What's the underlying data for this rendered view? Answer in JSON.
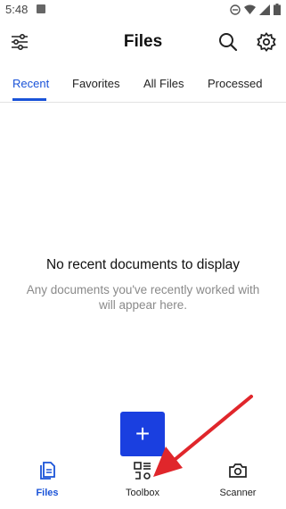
{
  "status_bar": {
    "time": "5:48"
  },
  "header": {
    "title": "Files"
  },
  "tabs": [
    {
      "label": "Recent"
    },
    {
      "label": "Favorites"
    },
    {
      "label": "All Files"
    },
    {
      "label": "Processed"
    }
  ],
  "empty_state": {
    "title": "No recent documents to display",
    "description": "Any documents you've recently worked with will appear here."
  },
  "fab": {
    "label": "+"
  },
  "bottom_nav": [
    {
      "label": "Files",
      "icon": "files-icon"
    },
    {
      "label": "Toolbox",
      "icon": "toolbox-icon"
    },
    {
      "label": "Scanner",
      "icon": "camera-icon"
    }
  ],
  "colors": {
    "accent": "#1a53d8",
    "fab": "#1a3fe0",
    "annotation_arrow": "#e0262b"
  }
}
